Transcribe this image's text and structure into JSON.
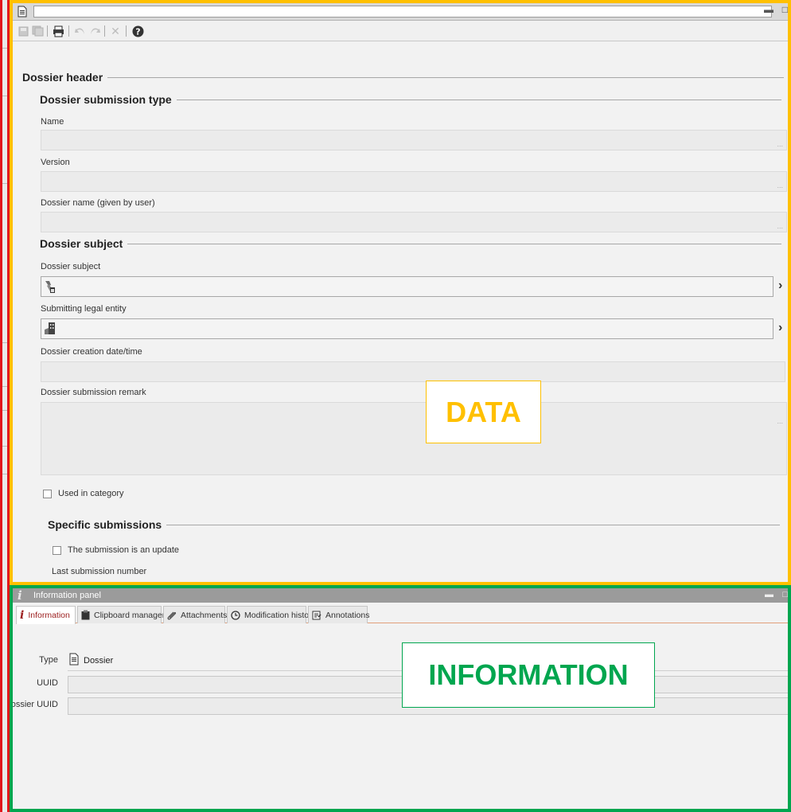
{
  "data_panel": {
    "toolbar": {
      "save": "save-icon",
      "save_all": "save-all-icon",
      "print": "print-icon",
      "undo": "undo-icon",
      "redo": "redo-icon",
      "delete": "delete-icon",
      "help": "help-icon"
    },
    "header_title": "Dossier header",
    "submission_type": {
      "title": "Dossier submission type",
      "name_label": "Name",
      "version_label": "Version",
      "dossier_name_label": "Dossier name (given by user)",
      "picker": "..."
    },
    "subject": {
      "title": "Dossier subject",
      "subject_label": "Dossier subject",
      "legal_entity_label": "Submitting legal entity",
      "creation_label": "Dossier creation date/time",
      "remark_label": "Dossier submission remark",
      "used_in_category": "Used in category"
    },
    "specific": {
      "title": "Specific submissions",
      "update_checkbox": "The submission is an update",
      "last_number_label": "Last submission number"
    },
    "annotation": "DATA",
    "annotation_color": "#ffc000"
  },
  "info_panel": {
    "title": "Information panel",
    "tabs": [
      {
        "label": "Information",
        "icon": "info-icon"
      },
      {
        "label": "Clipboard manager",
        "icon": "clipboard-icon"
      },
      {
        "label": "Attachments",
        "icon": "paperclip-icon"
      },
      {
        "label": "Modification history",
        "icon": "clock-icon"
      },
      {
        "label": "Annotations",
        "icon": "annotation-icon"
      }
    ],
    "type_label": "Type",
    "type_value": "Dossier",
    "uuid_label": "UUID",
    "dossier_uuid_label": "Dossier UUID",
    "annotation": "INFORMATION",
    "annotation_color": "#00a64f"
  },
  "frame_colors": {
    "left": "#e2151b",
    "data": "#ffc000",
    "info": "#00a64f"
  }
}
